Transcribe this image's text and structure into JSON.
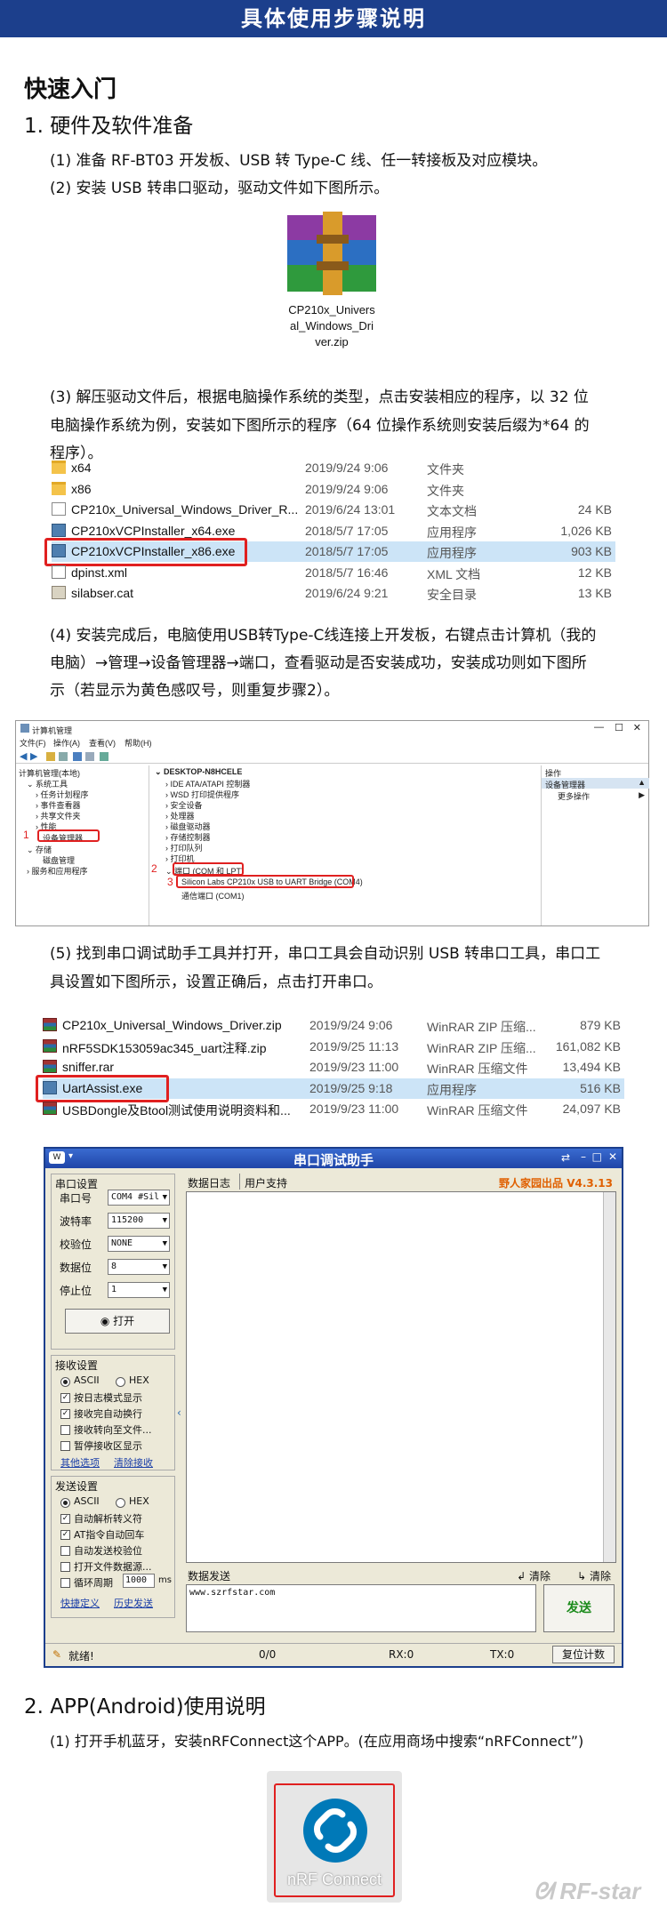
{
  "banner": "具体使用步骤说明",
  "quickstart": "快速入门",
  "section1": {
    "title": "1. 硬件及软件准备",
    "step1": "(1) 准备 RF-BT03 开发板、USB 转 Type-C 线、任一转接板及对应模块。",
    "step2": "(2) 安装 USB 转串口驱动，驱动文件如下图所示。",
    "zip_name_l1": "CP210x_Univers",
    "zip_name_l2": "al_Windows_Dri",
    "zip_name_l3": "ver.zip",
    "step3_l1": "(3) 解压驱动文件后，根据电脑操作系统的类型，点击安装相应的程序，以 32 位",
    "step3_l2": "电脑操作系统为例，安装如下图所示的程序（64 位操作系统则安装后缀为*64 的",
    "step3_l3": "程序）。",
    "files1": [
      {
        "name": "x64",
        "date": "2019/9/24 9:06",
        "type": "文件夹",
        "size": "",
        "icon": "folder-icon"
      },
      {
        "name": "x86",
        "date": "2019/9/24 9:06",
        "type": "文件夹",
        "size": "",
        "icon": "folder-icon"
      },
      {
        "name": "CP210x_Universal_Windows_Driver_R...",
        "date": "2019/6/24 13:01",
        "type": "文本文档",
        "size": "24 KB",
        "icon": "text-file-icon"
      },
      {
        "name": "CP210xVCPInstaller_x64.exe",
        "date": "2018/5/7 17:05",
        "type": "应用程序",
        "size": "1,026 KB",
        "icon": "installer-icon"
      },
      {
        "name": "CP210xVCPInstaller_x86.exe",
        "date": "2018/5/7 17:05",
        "type": "应用程序",
        "size": "903 KB",
        "icon": "installer-icon"
      },
      {
        "name": "dpinst.xml",
        "date": "2018/5/7 16:46",
        "type": "XML 文档",
        "size": "12 KB",
        "icon": "xml-file-icon"
      },
      {
        "name": "silabser.cat",
        "date": "2019/6/24 9:21",
        "type": "安全目录",
        "size": "13 KB",
        "icon": "catalog-file-icon"
      }
    ],
    "step4_l1": "(4) 安装完成后，电脑使用USB转Type-C线连接上开发板，右键点击计算机（我的",
    "step4_l2": "电脑）→管理→设备管理器→端口，查看驱动是否安装成功，安装成功则如下图所",
    "step4_l3": "示（若显示为黄色感叹号，则重复步骤2）。",
    "step5_l1": "(5) 找到串口调试助手工具并打开，串口工具会自动识别 USB 转串口工具，串口工",
    "step5_l2": "具设置如下图所示，设置正确后，点击打开串口。",
    "files2": [
      {
        "name": "CP210x_Universal_Windows_Driver.zip",
        "date": "2019/9/24 9:06",
        "type": "WinRAR ZIP 压缩...",
        "size": "879 KB",
        "icon": "winrar-icon"
      },
      {
        "name": "nRF5SDK153059ac345_uart注释.zip",
        "date": "2019/9/25 11:13",
        "type": "WinRAR ZIP 压缩...",
        "size": "161,082 KB",
        "icon": "winrar-icon"
      },
      {
        "name": "sniffer.rar",
        "date": "2019/9/23 11:00",
        "type": "WinRAR 压缩文件",
        "size": "13,494 KB",
        "icon": "winrar-icon"
      },
      {
        "name": "UartAssist.exe",
        "date": "2019/9/25 9:18",
        "type": "应用程序",
        "size": "516 KB",
        "icon": "uartassist-icon"
      },
      {
        "name": "USBDongle及Btool测试使用说明资料和...",
        "date": "2019/9/23 11:00",
        "type": "WinRAR 压缩文件",
        "size": "24,097 KB",
        "icon": "winrar-icon"
      }
    ]
  },
  "devmgr": {
    "title": "计算机管理",
    "menu": [
      "文件(F)",
      "操作(A)",
      "查看(V)",
      "帮助(H)"
    ],
    "tree_root": "计算机管理(本地)",
    "tree": [
      "系统工具",
      "任务计划程序",
      "事件查看器",
      "共享文件夹",
      "性能",
      "设备管理器",
      "存储",
      "磁盘管理",
      "服务和应用程序"
    ],
    "device_root": "DESKTOP-N8HCELE",
    "devices": [
      "IDE ATA/ATAPI 控制器",
      "WSD 打印提供程序",
      "安全设备",
      "处理器",
      "磁盘驱动器",
      "存储控制器",
      "打印队列",
      "打印机"
    ],
    "ports": "端口 (COM 和 LPT)",
    "silicon": "Silicon Labs CP210x USB to UART Bridge (COM4)",
    "com1": "通信端口 (COM1)",
    "actions_title": "操作",
    "actions_item": "设备管理器",
    "actions_more": "更多操作",
    "marks": [
      "1",
      "2",
      "3"
    ]
  },
  "serial": {
    "title": "串口调试助手",
    "brand": "野人家园出品 V4.3.13",
    "group_port": "串口设置",
    "labels": [
      "串口号",
      "波特率",
      "校验位",
      "数据位",
      "停止位"
    ],
    "values": [
      "COM4 #Sil",
      "115200",
      "NONE",
      "8",
      "1"
    ],
    "open_btn": "打开",
    "group_recv": "接收设置",
    "ascii": "ASCII",
    "hex": "HEX",
    "recv_opts": [
      "按日志模式显示",
      "接收完自动换行",
      "接收转向至文件...",
      "暂停接收区显示"
    ],
    "recv_links": [
      "其他选项",
      "清除接收"
    ],
    "group_send": "发送设置",
    "send_opts": [
      "自动解析转义符",
      "AT指令自动回车",
      "自动发送校验位",
      "打开文件数据源...",
      "循环周期"
    ],
    "period": "1000",
    "period_unit": "ms",
    "send_links": [
      "快捷定义",
      "历史发送"
    ],
    "tabs": [
      "数据日志",
      "用户支持"
    ],
    "send_tab": "数据发送",
    "clear1": "清除",
    "clear2": "清除",
    "send_text": "www.szrfstar.com",
    "send_btn": "发送",
    "status": [
      "就绪!",
      "0/0",
      "RX:0",
      "TX:0",
      "复位计数"
    ]
  },
  "section2": {
    "title": "2. APP(Android)使用说明",
    "step1": "(1) 打开手机蓝牙，安装nRFConnect这个APP。(在应用商场中搜索“nRFConnect”)",
    "app_label": "nRF Connect"
  },
  "watermark": "RF-star",
  "colors": {
    "banner": "#1c3f8c",
    "highlight": "#e02020",
    "brand": "#e06000",
    "app_bg": "#0079b8"
  }
}
